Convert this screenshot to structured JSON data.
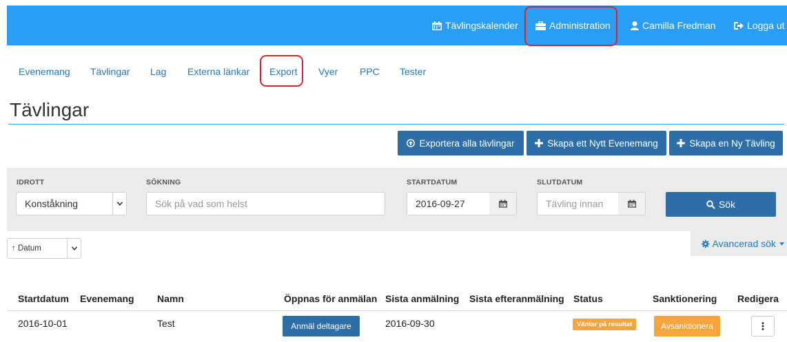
{
  "topnav": {
    "calendar": "Tävlingskalender",
    "admin": "Administration",
    "user": "Camilla Fredman",
    "logout": "Logga ut"
  },
  "subnav": [
    "Evenemang",
    "Tävlingar",
    "Lag",
    "Externa länkar",
    "Export",
    "Vyer",
    "PPC",
    "Tester"
  ],
  "page_title": "Tävlingar",
  "actions": {
    "export_all": "Exportera alla tävlingar",
    "create_event": "Skapa ett Nytt Evenemang",
    "create_competition": "Skapa en Ny Tävling"
  },
  "filters": {
    "sport_label": "IDROTT",
    "sport_value": "Konståkning",
    "search_label": "SÖKNING",
    "search_placeholder": "Sök på vad som helst",
    "start_label": "STARTDATUM",
    "start_value": "2016-09-27",
    "end_label": "SLUTDATUM",
    "end_placeholder": "Tävling innan",
    "search_button": "Sök"
  },
  "sort": {
    "value": "↑ Datum"
  },
  "advanced_search": "Avancerad sök",
  "table": {
    "headers": [
      "Startdatum",
      "Evenemang",
      "Namn",
      "Öppnas för anmälan",
      "Sista anmälning",
      "Sista efteranmälning",
      "Status",
      "Sanktionering",
      "Redigera"
    ],
    "rows": [
      {
        "startdatum": "2016-10-01",
        "evenemang": "",
        "namn": "Test",
        "register_button": "Anmäl deltagare",
        "sista_anmalning": "2016-09-30",
        "sista_efteranmalning": "",
        "status": "Väntar på resultat",
        "sanction_button": "Avsanktionera"
      }
    ]
  },
  "colors": {
    "topbar": "#2a9df4",
    "primary_button": "#2e6ea8",
    "link": "#1f7bc1",
    "warning": "#f6a43c",
    "highlight": "#d9232e"
  }
}
